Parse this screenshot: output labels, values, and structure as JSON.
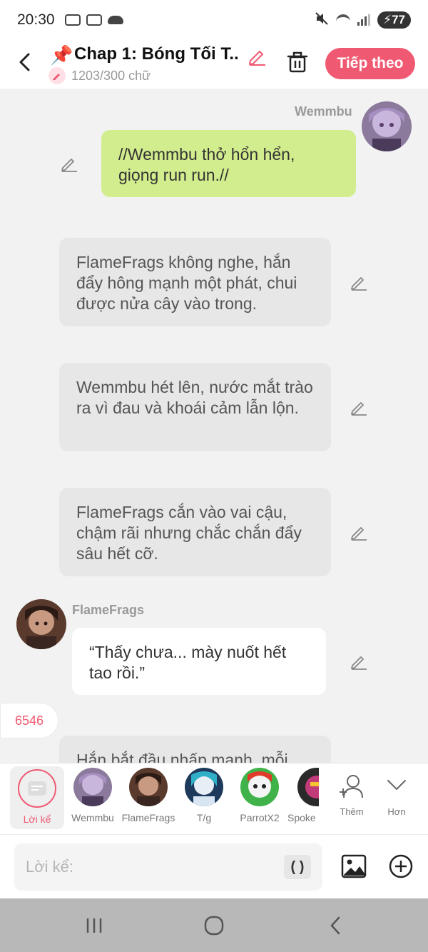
{
  "status": {
    "time": "20:30",
    "battery": "77"
  },
  "header": {
    "pin": "📌",
    "title": "Chap 1: Bóng Tối T...",
    "word_count": "1203/300 chữ",
    "next_label": "Tiếp theo"
  },
  "messages": [
    {
      "type": "character",
      "sender": "Wemmbu",
      "side": "right",
      "color": "green",
      "text": "//Wemmbu thở hổn hển, giọng run run.//"
    },
    {
      "type": "narration",
      "text": "FlameFrags không nghe, hắn đẩy hông mạnh một phát, chui được nửa cây vào trong."
    },
    {
      "type": "narration",
      "text": "Wemmbu hét lên, nước mắt trào ra vì đau và khoái cảm lẫn lộn."
    },
    {
      "type": "narration",
      "text": "FlameFrags cắn vào vai cậu, chậm rãi nhưng chắc chắn đẩy sâu hết cỡ."
    },
    {
      "type": "character",
      "sender": "FlameFrags",
      "side": "left",
      "color": "white",
      "text": "“Thấy chưa... mày nuốt hết tao rồi.”"
    },
    {
      "type": "narration",
      "text": "Hắn bắt đầu nhấp mạnh, mỗi"
    }
  ],
  "count_pill": "6546",
  "characters": [
    {
      "label": "Lời kể",
      "selected": true
    },
    {
      "label": "Wemmbu"
    },
    {
      "label": "FlameFrags"
    },
    {
      "label": "T/g"
    },
    {
      "label": "ParrotX2"
    },
    {
      "label": "Spoke"
    }
  ],
  "tools": {
    "more_label": "Thêm",
    "less_label": "Hơn"
  },
  "input": {
    "placeholder": "Lời kể:",
    "paren_label": "( )"
  },
  "colors": {
    "accent": "#ef5a72",
    "green_bubble": "#d2ed8d",
    "narration_bubble": "#e7e7e7"
  }
}
